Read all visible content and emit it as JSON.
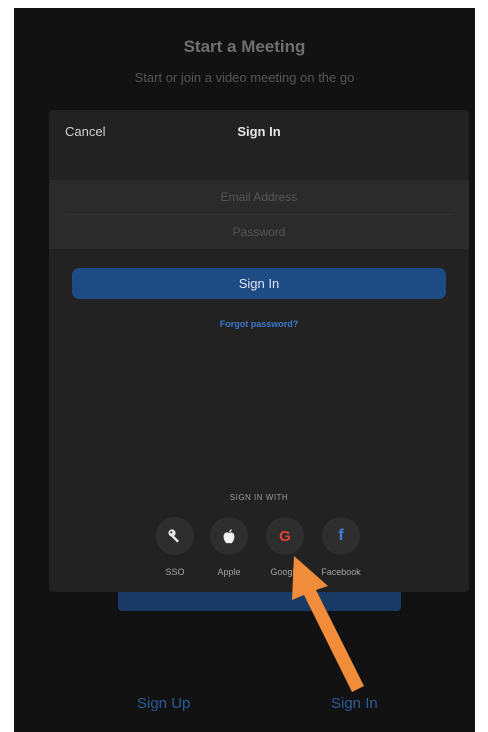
{
  "background": {
    "title": "Start a Meeting",
    "subtitle": "Start or join a video meeting on the go",
    "footer": {
      "sign_up_label": "Sign Up",
      "sign_in_label": "Sign In"
    }
  },
  "modal": {
    "cancel_label": "Cancel",
    "title": "Sign In",
    "email_placeholder": "Email Address",
    "password_placeholder": "Password",
    "sign_in_button_label": "Sign In",
    "forgot_password_label": "Forgot password?",
    "sign_in_with_label": "SIGN IN WITH",
    "providers": [
      {
        "label": "SSO",
        "icon": "key-icon"
      },
      {
        "label": "Apple",
        "icon": "apple-icon"
      },
      {
        "label": "Google",
        "icon": "google-icon"
      },
      {
        "label": "Facebook",
        "icon": "facebook-icon"
      }
    ]
  },
  "colors": {
    "screen_background": "#121212",
    "modal_background": "#222222",
    "primary_button": "#1f4b85",
    "link": "#3b78c9",
    "annotation_arrow": "#f08c3a"
  }
}
